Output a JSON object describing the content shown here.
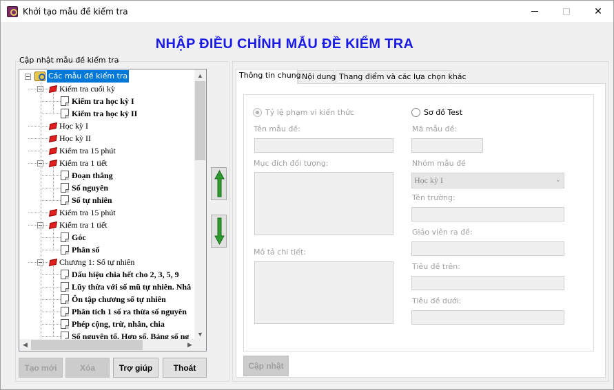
{
  "window": {
    "title": "Khởi tạo mẫu đề kiểm tra",
    "controls": {
      "minimize": "minimize",
      "maximize": "maximize",
      "close": "✕"
    }
  },
  "header": {
    "title": "NHẬP ĐIỀU CHỈNH MẪU ĐỀ KIỂM TRA"
  },
  "left_panel": {
    "group_label": "Cập nhật mẫu đề kiểm tra",
    "tree": [
      {
        "label": "Các mẫu đề kiểm tra",
        "level": 0,
        "icon": "root-folder-icon",
        "expanded": true,
        "selected": true
      },
      {
        "label": "Kiểm tra cuối kỳ",
        "level": 1,
        "icon": "book-icon",
        "expanded": true
      },
      {
        "label": "Kiểm tra học kỳ I",
        "level": 2,
        "icon": "document-icon",
        "bold": true
      },
      {
        "label": "Kiểm tra học kỳ II",
        "level": 2,
        "icon": "document-icon",
        "bold": true
      },
      {
        "label": "Học kỳ I",
        "level": 1,
        "icon": "book-icon"
      },
      {
        "label": "Học kỳ II",
        "level": 1,
        "icon": "book-icon"
      },
      {
        "label": "Kiểm tra 15 phút",
        "level": 1,
        "icon": "book-icon"
      },
      {
        "label": "Kiểm tra 1 tiết",
        "level": 1,
        "icon": "book-icon",
        "expanded": true
      },
      {
        "label": "Đoạn thẳng",
        "level": 2,
        "icon": "document-icon",
        "bold": true
      },
      {
        "label": "Số nguyên",
        "level": 2,
        "icon": "document-icon",
        "bold": true
      },
      {
        "label": "Số tự nhiên",
        "level": 2,
        "icon": "document-icon",
        "bold": true
      },
      {
        "label": "Kiểm tra 15 phút",
        "level": 1,
        "icon": "book-icon"
      },
      {
        "label": "Kiểm tra 1 tiết",
        "level": 1,
        "icon": "book-icon",
        "expanded": true
      },
      {
        "label": "Góc",
        "level": 2,
        "icon": "document-icon",
        "bold": true
      },
      {
        "label": "Phân số",
        "level": 2,
        "icon": "document-icon",
        "bold": true
      },
      {
        "label": "Chương 1: Số tự nhiên",
        "level": 1,
        "icon": "book-icon",
        "expanded": true
      },
      {
        "label": "Dấu hiệu chia hết cho 2, 3, 5, 9",
        "level": 2,
        "icon": "document-icon",
        "bold": true
      },
      {
        "label": "Lũy thừa với số mũ tự nhiên. Nhâ",
        "level": 2,
        "icon": "document-icon",
        "bold": true
      },
      {
        "label": "Ôn tập chương số tự nhiên",
        "level": 2,
        "icon": "document-icon",
        "bold": true
      },
      {
        "label": "Phân tích 1 số ra thừa số nguyên",
        "level": 2,
        "icon": "document-icon",
        "bold": true
      },
      {
        "label": "Phép cộng, trừ, nhân, chia",
        "level": 2,
        "icon": "document-icon",
        "bold": true
      },
      {
        "label": "Số nguyên tố. Hợp số. Bảng số ng",
        "level": 2,
        "icon": "document-icon",
        "bold": true
      }
    ],
    "buttons": {
      "new": "Tạo mới",
      "delete": "Xóa",
      "help": "Trợ giúp",
      "exit": "Thoát"
    }
  },
  "move_buttons": {
    "up": "move-up-arrow",
    "down": "move-down-arrow"
  },
  "tabs": [
    {
      "label": "Thông tin chung",
      "active": true
    },
    {
      "label": "Nội dung",
      "active": false
    },
    {
      "label": "Thang điểm và các lựa chọn khác",
      "active": false
    }
  ],
  "form": {
    "radio_ratio": "Tỷ lệ phạm vi kiến thức",
    "radio_test": "Sơ đồ Test",
    "template_name_label": "Tên mẫu đề:",
    "template_name_value": "",
    "template_code_label": "Mã mẫu đề:",
    "template_code_value": "",
    "purpose_label": "Mục đích đối tượng:",
    "group_label": "Nhóm mẫu đề",
    "group_value": "Học kỳ I",
    "school_label": "Tên trường:",
    "teacher_label": "Giáo viên ra đề:",
    "detail_label": "Mô tả chi tiết:",
    "header_top_label": "Tiêu đề trên:",
    "header_bottom_label": "Tiêu đề dưới:",
    "update_button": "Cập nhật"
  }
}
